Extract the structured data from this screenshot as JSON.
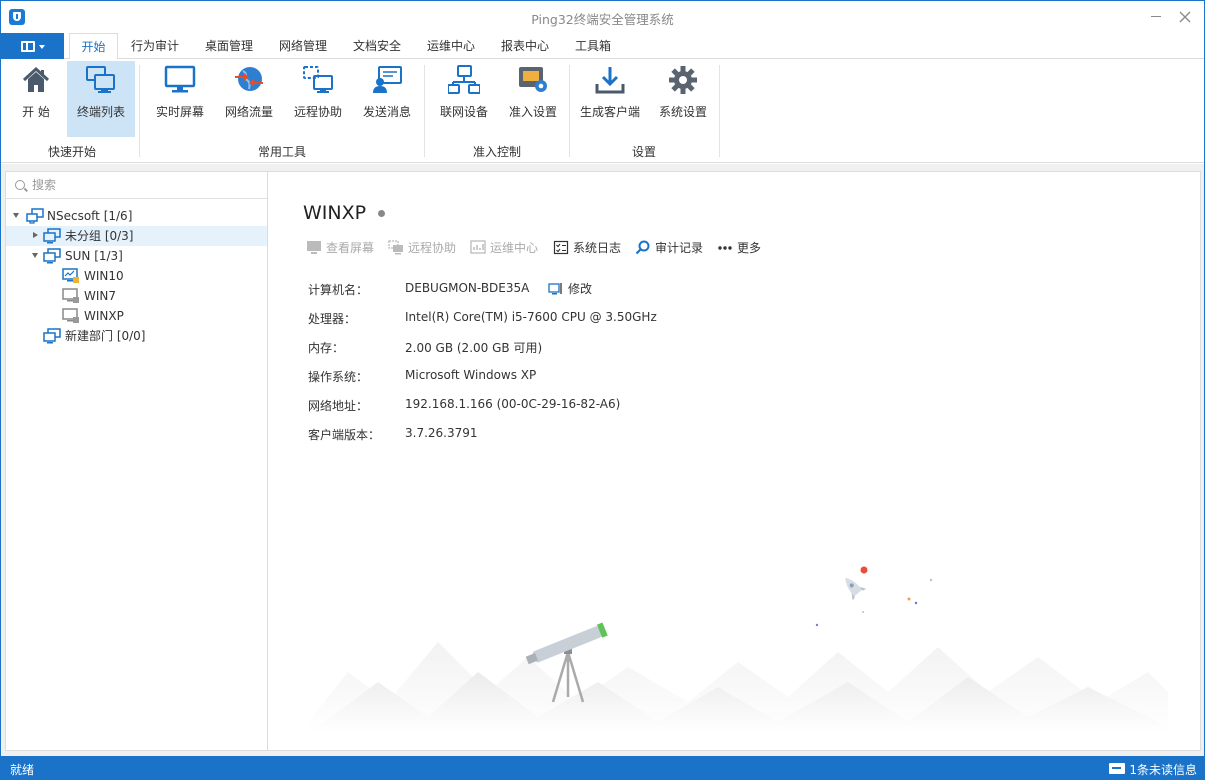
{
  "window": {
    "title": "Ping32终端安全管理系统"
  },
  "menu": {
    "tabs": [
      "开始",
      "行为审计",
      "桌面管理",
      "网络管理",
      "文档安全",
      "运维中心",
      "报表中心",
      "工具箱"
    ],
    "active_tab": "开始"
  },
  "ribbon": {
    "groups": [
      {
        "label": "快速开始",
        "buttons": [
          "开 始",
          "终端列表"
        ]
      },
      {
        "label": "常用工具",
        "buttons": [
          "实时屏幕",
          "网络流量",
          "远程协助",
          "发送消息"
        ]
      },
      {
        "label": "准入控制",
        "buttons": [
          "联网设备",
          "准入设置"
        ]
      },
      {
        "label": "设置",
        "buttons": [
          "生成客户端",
          "系统设置"
        ]
      }
    ],
    "selected_button": "终端列表"
  },
  "sidebar": {
    "search_placeholder": "搜索",
    "tree": [
      {
        "label": "NSecsoft  [1/6]",
        "level": 0,
        "expanded": true,
        "icon": "network-group-icon"
      },
      {
        "label": "未分组  [0/3]",
        "level": 1,
        "expanded": false,
        "icon": "monitor-group-icon",
        "highlighted": true
      },
      {
        "label": "SUN  [1/3]",
        "level": 1,
        "expanded": true,
        "icon": "monitor-group-icon"
      },
      {
        "label": "WIN10",
        "level": 2,
        "icon": "online-pc-icon"
      },
      {
        "label": "WIN7",
        "level": 2,
        "icon": "offline-pc-icon"
      },
      {
        "label": "WINXP",
        "level": 2,
        "icon": "offline-pc-icon"
      },
      {
        "label": "新建部门  [0/0]",
        "level": 1,
        "icon": "monitor-group-icon"
      }
    ]
  },
  "detail": {
    "computer_title": "WINXP",
    "actions": [
      {
        "label": "查看屏幕",
        "enabled": false,
        "icon": "monitor-icon"
      },
      {
        "label": "远程协助",
        "enabled": false,
        "icon": "remote-icon"
      },
      {
        "label": "运维中心",
        "enabled": false,
        "icon": "ops-icon"
      },
      {
        "label": "系统日志",
        "enabled": true,
        "icon": "log-icon"
      },
      {
        "label": "审计记录",
        "enabled": true,
        "icon": "search-icon"
      },
      {
        "label": "更多",
        "enabled": true,
        "icon": "more-icon"
      }
    ],
    "edit_label": "修改",
    "info": [
      {
        "label": "计算机名：",
        "value": "DEBUGMON-BDE35A"
      },
      {
        "label": "处理器：",
        "value": "Intel(R) Core(TM) i5-7600 CPU @ 3.50GHz"
      },
      {
        "label": "内存：",
        "value": "2.00 GB (2.00 GB 可用)"
      },
      {
        "label": "操作系统：",
        "value": "Microsoft Windows XP"
      },
      {
        "label": "网络地址：",
        "value": "192.168.1.166  (00-0C-29-16-82-A6)"
      },
      {
        "label": "客户端版本：",
        "value": "3.7.26.3791"
      }
    ]
  },
  "statusbar": {
    "left": "就绪",
    "right": "1条未读信息"
  },
  "colors": {
    "accent": "#1a73c8",
    "selected_bg": "#cde4f7",
    "tree_highlight": "#e5f1fb",
    "disabled_text": "#aaaaaa"
  }
}
